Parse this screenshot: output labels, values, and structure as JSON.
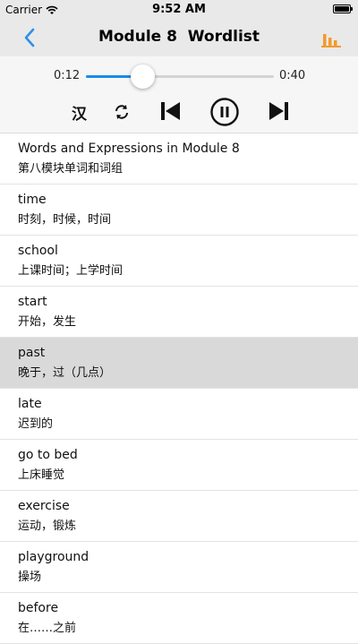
{
  "status_bar": {
    "carrier": "Carrier",
    "time": "9:52 AM"
  },
  "nav": {
    "title": "Module 8  Wordlist",
    "accent_color": "#2f8fe8",
    "chart_color": "#f39a2c"
  },
  "player": {
    "current_time": "0:12",
    "total_time": "0:40",
    "progress": 0.3,
    "language_toggle": "汉",
    "state": "playing"
  },
  "wordlist": {
    "items": [
      {
        "en": "Words and Expressions in Module 8",
        "zh": "第八模块单词和词组",
        "selected": false
      },
      {
        "en": "time",
        "zh": "时刻，时候，时间",
        "selected": false
      },
      {
        "en": "school",
        "zh": "上课时间；上学时间",
        "selected": false
      },
      {
        "en": "start",
        "zh": "开始，发生",
        "selected": false
      },
      {
        "en": "past",
        "zh": "晚于，过（几点）",
        "selected": true
      },
      {
        "en": "late",
        "zh": "迟到的",
        "selected": false
      },
      {
        "en": "go to bed",
        "zh": "上床睡觉",
        "selected": false
      },
      {
        "en": "exercise",
        "zh": "运动，锻炼",
        "selected": false
      },
      {
        "en": "playground",
        "zh": "操场",
        "selected": false
      },
      {
        "en": "before",
        "zh": "在……之前",
        "selected": false
      }
    ]
  }
}
